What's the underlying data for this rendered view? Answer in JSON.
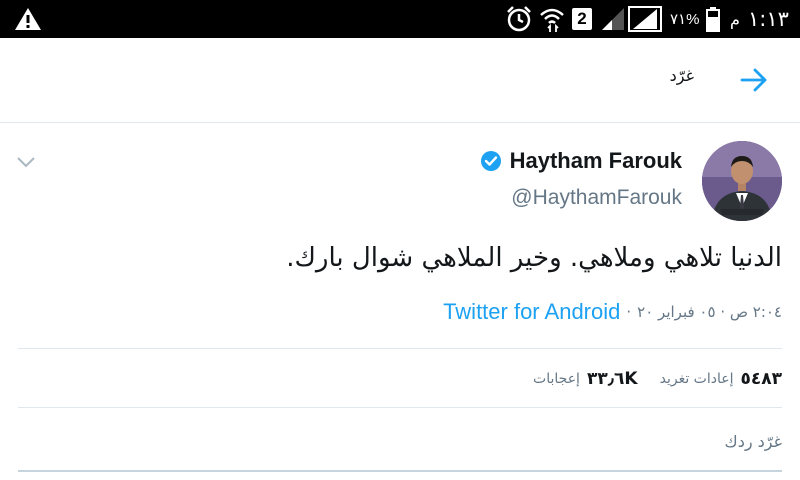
{
  "status_bar": {
    "time": "١:١٣",
    "ampm": "م",
    "battery": "٧١%",
    "sim": "2",
    "icons": [
      "warning-icon",
      "alarm-icon",
      "wifi-icon",
      "sim2-icon",
      "signal-weak-icon",
      "signal-full-icon",
      "battery-icon"
    ]
  },
  "header": {
    "title": "غرّد",
    "back_icon": "arrow-right-icon"
  },
  "tweet": {
    "author_name": "Haytham Farouk",
    "verified": true,
    "handle": "@HaythamFarouk",
    "text": "الدنيا تلاهي وملاهي. وخير الملاهي  شوال  بارك.",
    "timestamp": "٢:٠٤ ص · ٠٥ فبراير ٢٠",
    "separator": "·",
    "source": "Twitter for Android"
  },
  "stats": {
    "retweets_count": "٥٤٨٣",
    "retweets_label": "إعادات تغريد",
    "likes_count": "٣٣٫٦K",
    "likes_label": "إعجابات"
  },
  "reply": {
    "placeholder": "غرّد ردك"
  },
  "colors": {
    "accent": "#1da1f2",
    "text": "#14171a",
    "muted": "#657786",
    "divider": "#e1e8ed"
  }
}
